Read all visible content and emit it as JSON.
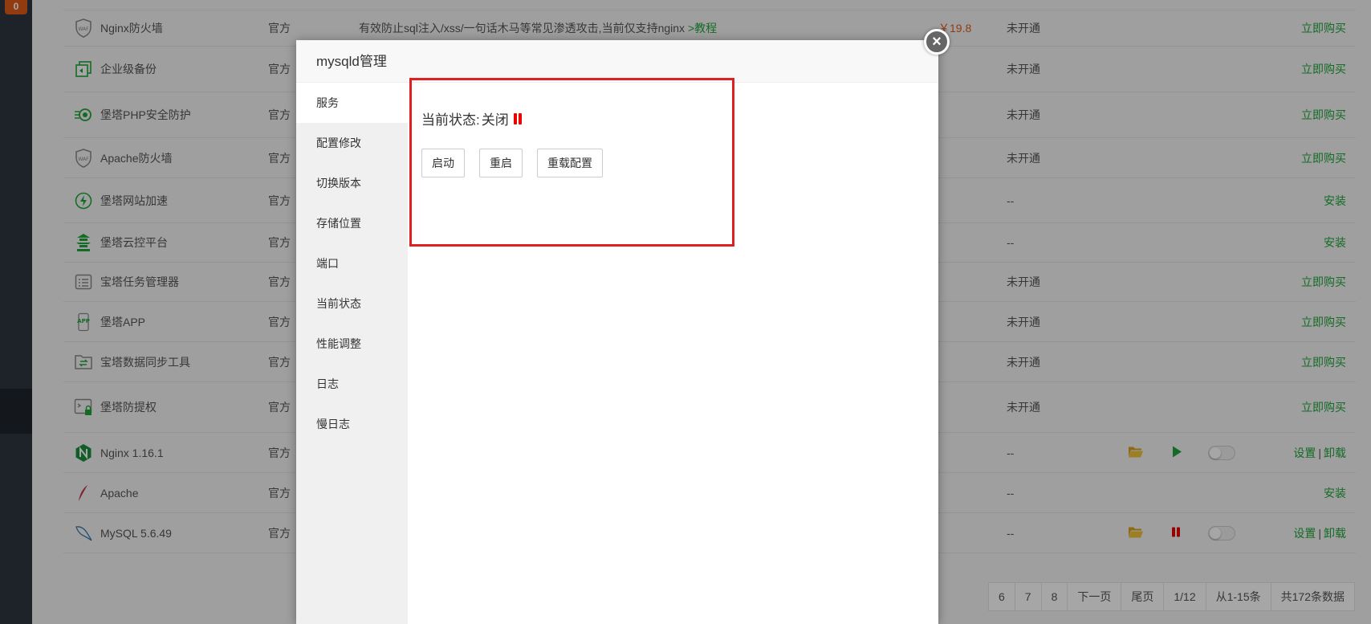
{
  "sidebar": {
    "badge": "0"
  },
  "plugins": [
    {
      "icon": "waf-shield-icon",
      "name": "Nginx防火墙",
      "type": "官方",
      "desc": "有效防止sql注入/xss/一句话木马等常见渗透攻击,当前仅支持nginx ",
      "desc_link": ">教程",
      "price": "￥19.8",
      "expire": "未开通",
      "ops": "立即购买"
    },
    {
      "icon": "backup-icon",
      "name": "企业级备份",
      "type": "官方",
      "desc": "",
      "desc_link": "",
      "price": "",
      "expire": "未开通",
      "ops": "立即购买"
    },
    {
      "icon": "php-guard-icon",
      "name": "堡塔PHP安全防护",
      "type": "官方",
      "desc": "",
      "desc_link": "",
      "price": "",
      "expire": "未开通",
      "ops": "立即购买"
    },
    {
      "icon": "waf-shield-icon",
      "name": "Apache防火墙",
      "type": "官方",
      "desc": "",
      "desc_link": "",
      "price": "",
      "expire": "未开通",
      "ops": "立即购买"
    },
    {
      "icon": "lightning-icon",
      "name": "堡塔网站加速",
      "type": "官方",
      "desc": "",
      "desc_link": "",
      "price": "",
      "expire": "--",
      "ops": "安装"
    },
    {
      "icon": "pagoda-icon",
      "name": "堡塔云控平台",
      "type": "官方",
      "desc": "",
      "desc_link": "",
      "price": "",
      "expire": "--",
      "ops": "安装"
    },
    {
      "icon": "task-list-icon",
      "name": "宝塔任务管理器",
      "type": "官方",
      "desc": "",
      "desc_link": "",
      "price": "",
      "expire": "未开通",
      "ops": "立即购买"
    },
    {
      "icon": "app-icon",
      "name": "堡塔APP",
      "type": "官方",
      "desc": "",
      "desc_link": "",
      "price": "",
      "expire": "未开通",
      "ops": "立即购买"
    },
    {
      "icon": "sync-folder-icon",
      "name": "宝塔数据同步工具",
      "type": "官方",
      "desc": "",
      "desc_link": "",
      "price": "",
      "expire": "未开通",
      "ops": "立即购买"
    },
    {
      "icon": "terminal-lock-icon",
      "name": "堡塔防提权",
      "type": "官方",
      "desc": "",
      "desc_link": "",
      "price": "",
      "expire": "未开通",
      "ops": "立即购买"
    },
    {
      "icon": "nginx-icon",
      "name": "Nginx 1.16.1",
      "type": "官方",
      "desc": "",
      "desc_link": "",
      "price": "",
      "expire": "--",
      "ops_set": "设置",
      "ops_sep": "|",
      "ops_uninstall": "卸载",
      "ops": ""
    },
    {
      "icon": "apache-feather-icon",
      "name": "Apache",
      "type": "官方",
      "desc": "",
      "desc_link": "",
      "price": "",
      "expire": "--",
      "ops": "安装"
    },
    {
      "icon": "mysql-dolphin-icon",
      "name": "MySQL 5.6.49",
      "type": "官方",
      "desc": "",
      "desc_link": "",
      "price": "",
      "expire": "--",
      "ops_set": "设置",
      "ops_sep": "|",
      "ops_uninstall": "卸载",
      "ops": ""
    }
  ],
  "pager": [
    "6",
    "7",
    "8",
    "下一页",
    "尾页",
    "1/12",
    "从1-15条",
    "共172条数据"
  ],
  "modal": {
    "title": "mysqld管理",
    "close": "×",
    "nav": [
      "服务",
      "配置修改",
      "切换版本",
      "存储位置",
      "端口",
      "当前状态",
      "性能调整",
      "日志",
      "慢日志"
    ],
    "status_label": "当前状态:",
    "status_value": "关闭",
    "buttons": {
      "start": "启动",
      "restart": "重启",
      "reload": "重载配置"
    }
  },
  "colors": {
    "accent_green": "#20a53a",
    "price_orange": "#e05a1a",
    "highlight_red": "#e02020",
    "stopped_red": "#ee0000"
  }
}
